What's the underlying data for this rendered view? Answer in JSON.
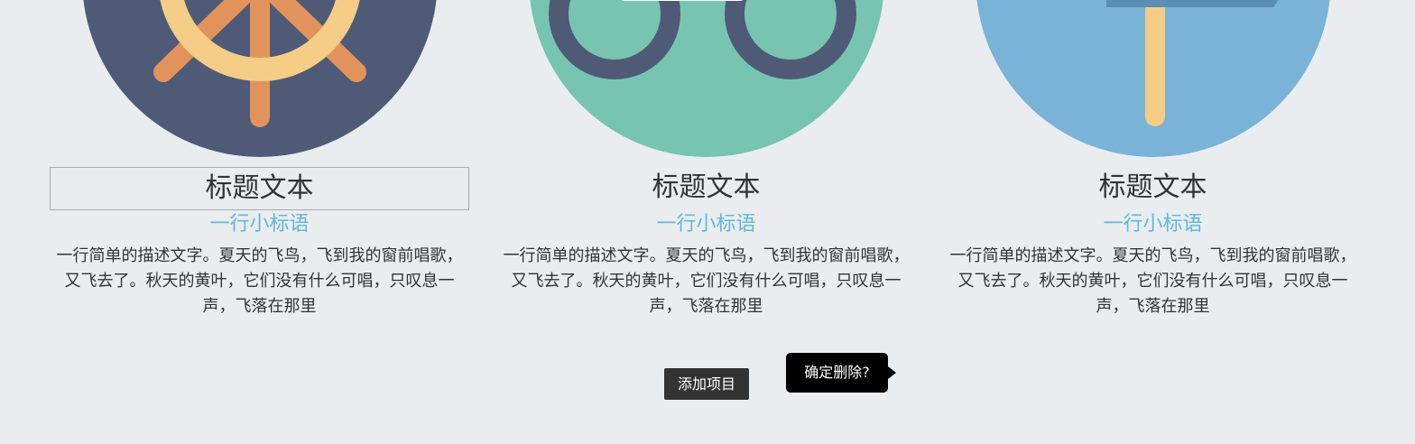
{
  "cards": [
    {
      "icon": "ship-wheel-icon",
      "circle_color": "#4f5b76",
      "title": "标题文本",
      "slogan": "一行小标语",
      "description": "一行简单的描述文字。夏天的飞鸟，飞到我的窗前唱歌，又飞去了。秋天的黄叶，它们没有什么可唱，只叹息一声，飞落在那里"
    },
    {
      "icon": "bicycle-icon",
      "circle_color": "#77c4b0",
      "title": "标题文本",
      "slogan": "一行小标语",
      "description": "一行简单的描述文字。夏天的飞鸟，飞到我的窗前唱歌，又飞去了。秋天的黄叶，它们没有什么可唱，只叹息一声，飞落在那里"
    },
    {
      "icon": "signpost-icon",
      "circle_color": "#7ab3d8",
      "title": "标题文本",
      "slogan": "一行小标语",
      "description": "一行简单的描述文字。夏天的飞鸟，飞到我的窗前唱歌，又飞去了。秋天的黄叶，它们没有什么可唱，只叹息一声，飞落在那里"
    }
  ],
  "actions": {
    "add_label": "添加项目",
    "confirm_delete_label": "确定删除?"
  },
  "colors": {
    "background": "#e9edf0",
    "slogan": "#63b7d9",
    "button": "#333333",
    "popover": "#000000"
  }
}
